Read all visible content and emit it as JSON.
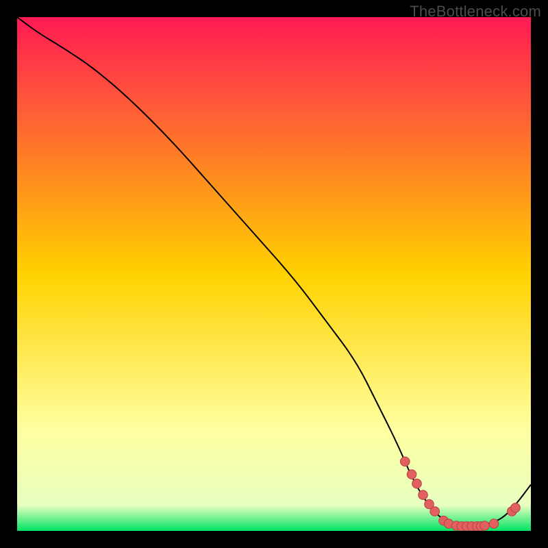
{
  "watermark": "TheBottleneck.com",
  "colors": {
    "background": "#000000",
    "watermark": "#4c4c4c",
    "gradient_top": "#ff1a54",
    "gradient_mid": "#ffd200",
    "gradient_pale": "#ffff9f",
    "gradient_green": "#00e364",
    "curve": "#000000",
    "dot_fill": "#e36060",
    "dot_stroke": "#b84444"
  },
  "chart_data": {
    "type": "line",
    "title": "",
    "xlabel": "",
    "ylabel": "",
    "xlim": [
      0,
      100
    ],
    "ylim": [
      0,
      100
    ],
    "grid": false,
    "legend": false,
    "curve": {
      "name": "bottleneck-curve",
      "x": [
        0,
        4,
        9,
        15,
        22,
        30,
        38,
        46,
        54,
        60,
        66,
        70,
        74,
        77,
        80,
        83,
        86,
        90,
        94,
        97,
        100
      ],
      "y": [
        100,
        97,
        94,
        90,
        84,
        76,
        67,
        58,
        49,
        41,
        33,
        25,
        17,
        10,
        5,
        2,
        1,
        1,
        2,
        5,
        9
      ]
    },
    "dots": {
      "name": "highlight-dots",
      "x": [
        75.5,
        76.8,
        77.8,
        79.0,
        80.2,
        81.3,
        83.0,
        84.0,
        85.5,
        86.5,
        87.5,
        88.5,
        89.5,
        90.3,
        91.0,
        92.8,
        96.3,
        97.0
      ],
      "y": [
        13.5,
        11.0,
        9.2,
        7.0,
        5.2,
        3.8,
        2.0,
        1.4,
        1.0,
        0.9,
        0.9,
        0.9,
        0.9,
        0.9,
        1.0,
        1.4,
        3.8,
        4.5
      ]
    }
  }
}
